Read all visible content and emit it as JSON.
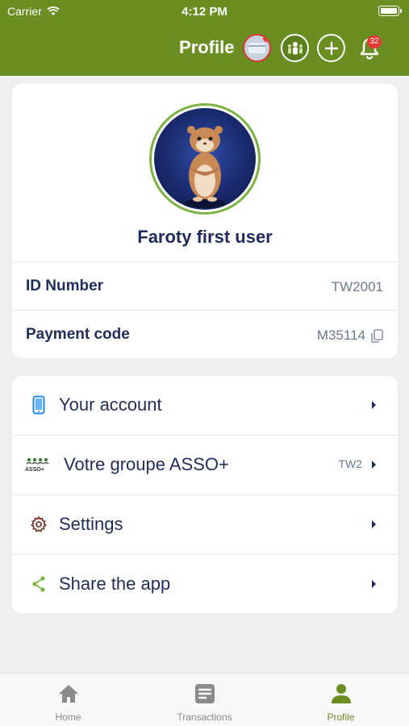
{
  "status_bar": {
    "carrier": "Carrier",
    "time": "4:12 PM"
  },
  "header": {
    "title": "Profile",
    "notification_count": "32",
    "accent_color": "#6b8e23"
  },
  "profile": {
    "name": "Faroty first user",
    "id_label": "ID Number",
    "id_value": "TW2001",
    "payment_label": "Payment code",
    "payment_value": "M35114"
  },
  "menu": {
    "items": [
      {
        "label": "Your account",
        "icon": "phone-icon",
        "meta": ""
      },
      {
        "label": "Votre groupe ASSO+",
        "icon": "asso-group-icon",
        "meta": "TW2",
        "logo_text": "ASSO+"
      },
      {
        "label": "Settings",
        "icon": "gear-icon",
        "meta": ""
      },
      {
        "label": "Share the app",
        "icon": "share-icon",
        "meta": ""
      }
    ]
  },
  "tabbar": {
    "tabs": [
      {
        "label": "Home",
        "icon": "home-icon",
        "active": false
      },
      {
        "label": "Transactions",
        "icon": "document-icon",
        "active": false
      },
      {
        "label": "Profile",
        "icon": "person-icon",
        "active": true
      }
    ]
  }
}
